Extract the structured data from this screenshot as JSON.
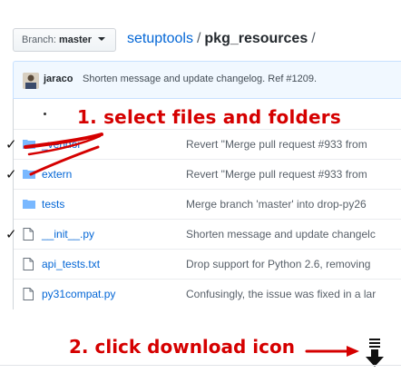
{
  "header": {
    "branch_label": "Branch:",
    "branch_value": "master",
    "repo_link": "setuptools",
    "path_separator": "/",
    "current_dir": "pkg_resources",
    "trailing_separator": "/"
  },
  "commit": {
    "author": "jaraco",
    "message": "Shorten message and update changelog. Ref #1209."
  },
  "files": [
    {
      "type": "folder",
      "name": "_vendor",
      "message": "Revert \"Merge pull request #933 from",
      "checked": true
    },
    {
      "type": "folder",
      "name": "extern",
      "message": "Revert \"Merge pull request #933 from",
      "checked": true
    },
    {
      "type": "folder",
      "name": "tests",
      "message": "Merge branch 'master' into drop-py26",
      "checked": false
    },
    {
      "type": "file",
      "name": "__init__.py",
      "message": "Shorten message and update changelc",
      "checked": true
    },
    {
      "type": "file",
      "name": "api_tests.txt",
      "message": "Drop support for Python 2.6, removing",
      "checked": false
    },
    {
      "type": "file",
      "name": "py31compat.py",
      "message": "Confusingly, the issue was fixed in a lar",
      "checked": false
    }
  ],
  "annotations": {
    "step1": "1. select files and folders",
    "step2": "2. click download icon",
    "check_mark": "✓",
    "color": "#d50000"
  },
  "icons": {
    "folder": "folder-icon",
    "file": "file-icon",
    "download": "download-icon"
  },
  "colors": {
    "link": "#0366d6",
    "commit_bg": "#f1f8ff",
    "folder": "#79b8ff"
  }
}
